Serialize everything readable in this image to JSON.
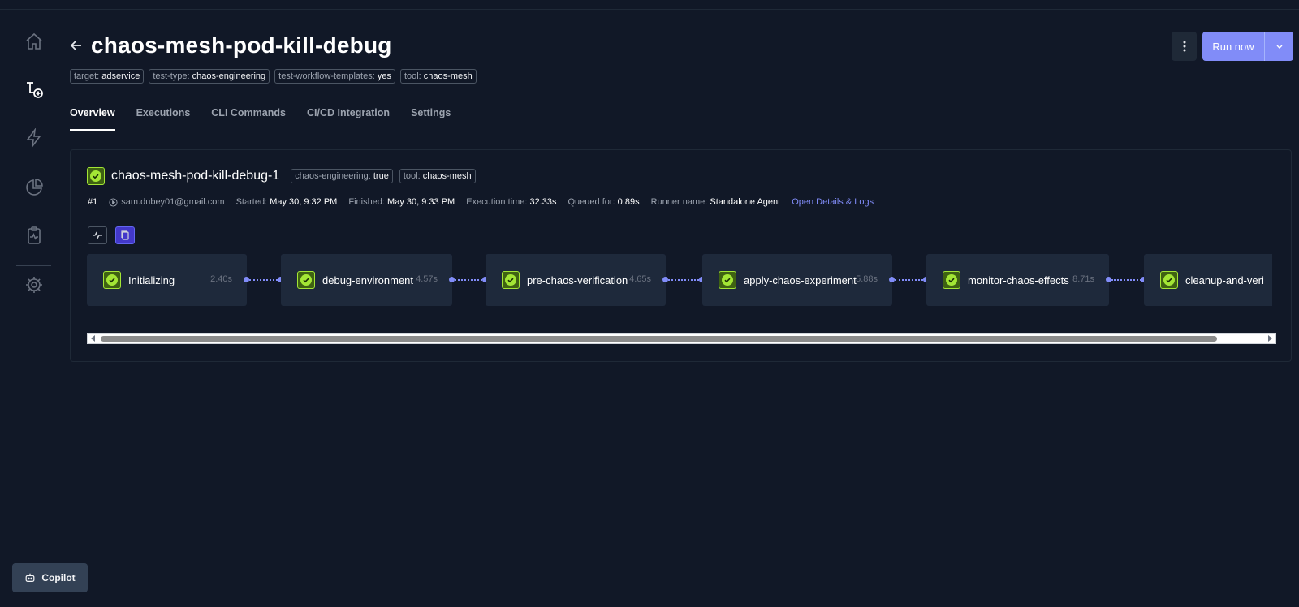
{
  "header": {
    "title": "chaos-mesh-pod-kill-debug",
    "tags": [
      {
        "key": "target:",
        "value": "adservice"
      },
      {
        "key": "test-type:",
        "value": "chaos-engineering"
      },
      {
        "key": "test-workflow-templates:",
        "value": "yes"
      },
      {
        "key": "tool:",
        "value": "chaos-mesh"
      }
    ],
    "run_label": "Run now"
  },
  "tabs": [
    {
      "label": "Overview"
    },
    {
      "label": "Executions"
    },
    {
      "label": "CLI Commands"
    },
    {
      "label": "CI/CD Integration"
    },
    {
      "label": "Settings"
    }
  ],
  "execution": {
    "name": "chaos-mesh-pod-kill-debug-1",
    "tags": [
      {
        "key": "chaos-engineering:",
        "value": "true"
      },
      {
        "key": "tool:",
        "value": "chaos-mesh"
      }
    ],
    "number": "#1",
    "user": "sam.dubey01@gmail.com",
    "started_label": "Started:",
    "started": "May 30, 9:32 PM",
    "finished_label": "Finished:",
    "finished": "May 30, 9:33 PM",
    "exec_time_label": "Execution time:",
    "exec_time": "32.33s",
    "queued_label": "Queued for:",
    "queued": "0.89s",
    "runner_label": "Runner name:",
    "runner": "Standalone Agent",
    "open_link": "Open Details & Logs"
  },
  "steps": [
    {
      "label": "Initializing",
      "duration": "2.40s"
    },
    {
      "label": "debug-environment",
      "duration": "4.57s"
    },
    {
      "label": "pre-chaos-verification",
      "duration": "4.65s"
    },
    {
      "label": "apply-chaos-experiment",
      "duration": "5.88s"
    },
    {
      "label": "monitor-chaos-effects",
      "duration": "8.71s"
    },
    {
      "label": "cleanup-and-veri",
      "duration": ""
    }
  ],
  "copilot": {
    "label": "Copilot"
  },
  "colors": {
    "accent": "#818cf8",
    "success": "#a3e635",
    "background": "#111827"
  }
}
